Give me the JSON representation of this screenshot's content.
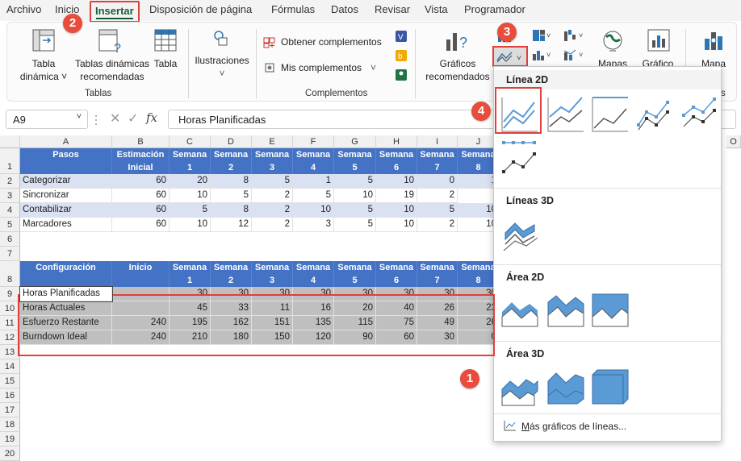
{
  "menu": {
    "tabs": [
      "Archivo",
      "Inicio",
      "Insertar",
      "Disposición de página",
      "Fórmulas",
      "Datos",
      "Revisar",
      "Vista",
      "Programador"
    ]
  },
  "ribbon": {
    "tabla_dinamica": [
      "Tabla",
      "dinámica ˅"
    ],
    "tablas_recomendadas": [
      "Tablas dinámicas",
      "recomendadas"
    ],
    "tabla": "Tabla",
    "group_tablas": "Tablas",
    "ilustraciones": "Ilustraciones",
    "ilustraciones_arrow": "˅",
    "obtener_complementos": "Obtener complementos",
    "mis_complementos": "Mis complementos",
    "group_complementos": "Complementos",
    "graficos_recomendados": [
      "Gráficos",
      "recomendados"
    ],
    "mapas": "Mapas",
    "grafico": "Gráfico",
    "mapa": "Mapa"
  },
  "badges": [
    "1",
    "2",
    "3",
    "4"
  ],
  "formula_bar": {
    "name_box": "A9",
    "fx": "fx",
    "value": "Horas Planificadas"
  },
  "columns": [
    "A",
    "B",
    "C",
    "D",
    "E",
    "F",
    "G",
    "H",
    "I",
    "J",
    "O"
  ],
  "rows": [
    "1",
    "2",
    "3",
    "4",
    "5",
    "6",
    "7",
    "8",
    "9",
    "10",
    "11",
    "12",
    "13",
    "14",
    "15",
    "16",
    "17",
    "18",
    "19",
    "20"
  ],
  "table1": {
    "header": [
      "Pasos",
      "Estimación Inicial",
      "Semana 1",
      "Semana 2",
      "Semana 3",
      "Semana 4",
      "Semana 5",
      "Semana 6",
      "Semana 7",
      "Semana 8"
    ],
    "rows": [
      [
        "Categorizar",
        "60",
        "20",
        "8",
        "5",
        "1",
        "5",
        "10",
        "0",
        "1"
      ],
      [
        "Sincronizar",
        "60",
        "10",
        "5",
        "2",
        "5",
        "10",
        "19",
        "2"
      ],
      [
        "Contabilizar",
        "60",
        "5",
        "8",
        "2",
        "10",
        "5",
        "10",
        "5",
        "10"
      ],
      [
        "Marcadores",
        "60",
        "10",
        "12",
        "2",
        "3",
        "5",
        "10",
        "2",
        "10"
      ]
    ]
  },
  "table2": {
    "header": [
      "Configuración",
      "Inicio",
      "Semana 1",
      "Semana 2",
      "Semana 3",
      "Semana 4",
      "Semana 5",
      "Semana 6",
      "Semana 7",
      "Semana 8"
    ],
    "rows": [
      [
        "Horas Planificadas",
        "",
        "30",
        "30",
        "30",
        "30",
        "30",
        "30",
        "30",
        "30"
      ],
      [
        "Horas Actuales",
        "",
        "45",
        "33",
        "11",
        "16",
        "20",
        "40",
        "26",
        "23"
      ],
      [
        "Esfuerzo Restante",
        "240",
        "195",
        "162",
        "151",
        "135",
        "115",
        "75",
        "49",
        "26"
      ],
      [
        "Burndown Ideal",
        "240",
        "210",
        "180",
        "150",
        "120",
        "90",
        "60",
        "30",
        "0"
      ]
    ]
  },
  "dropdown": {
    "linea2d": "Línea 2D",
    "lineas3d": "Líneas 3D",
    "area2d": "Área 2D",
    "area3d": "Área 3D",
    "more_prefix": "M",
    "more_rest": "ás gráficos de líneas..."
  },
  "colors": {
    "accent_green": "#185c37",
    "header_blue": "#4472c4",
    "band": "#d9e1f2",
    "highlight_red": "#e0403b",
    "chart_blue": "#5b9bd5"
  }
}
